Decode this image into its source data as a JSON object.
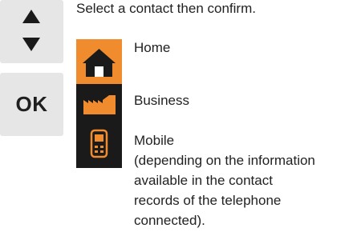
{
  "instruction": "Select a contact then confirm.",
  "keys": {
    "nav_up_icon": "arrow-up-icon",
    "nav_down_icon": "arrow-down-icon",
    "ok_label": "OK"
  },
  "contacts": [
    {
      "icon": "home-icon",
      "label": "Home",
      "selected": true
    },
    {
      "icon": "business-icon",
      "label": "Business",
      "selected": false
    },
    {
      "icon": "mobile-phone-icon",
      "label": "Mobile",
      "selected": false
    }
  ],
  "mobile_note_lines": [
    "(depending on the information",
    "available in the contact",
    "records of the telephone",
    "connected)."
  ],
  "colors": {
    "selection": "#f08c2e",
    "icon_accent": "#f08c2e",
    "icon_background": "#1a1a1a",
    "key_background": "#e6e6e6"
  }
}
